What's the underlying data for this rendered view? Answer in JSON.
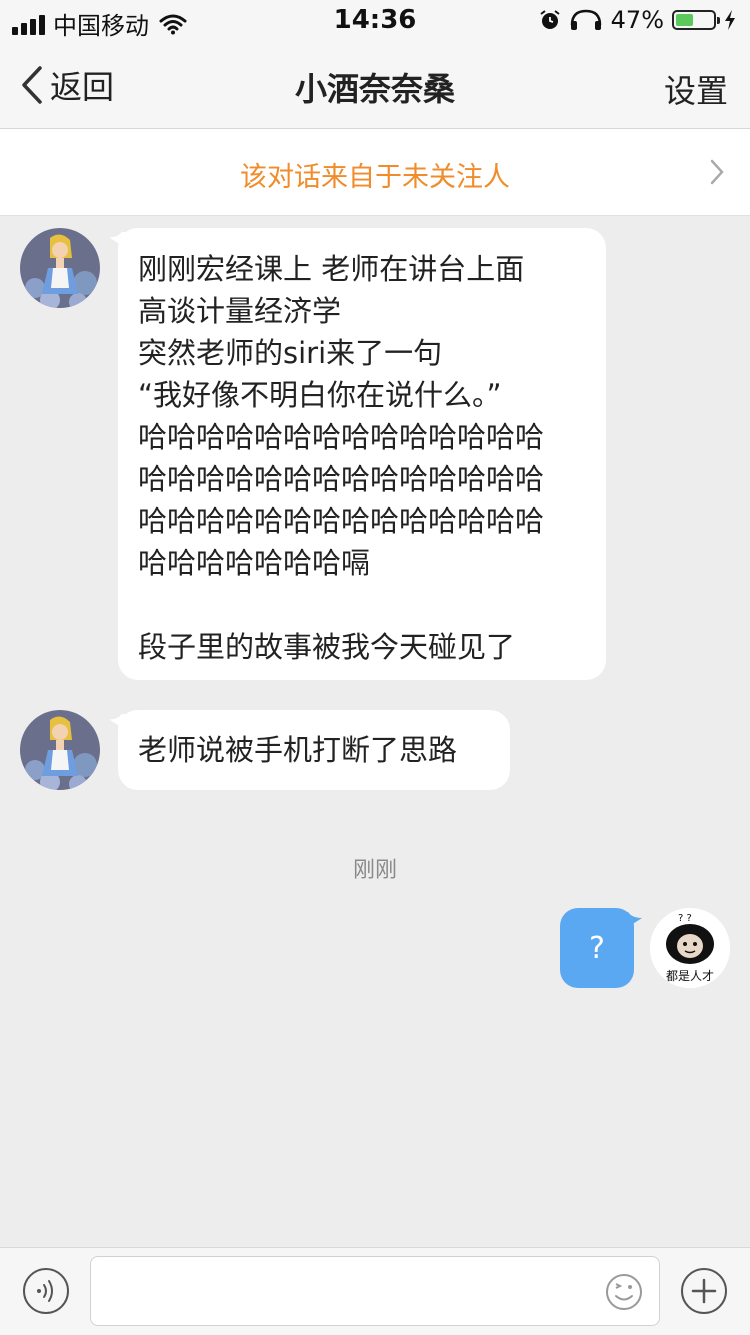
{
  "status_bar": {
    "carrier": "中国移动",
    "time": "14:36",
    "battery_percent": "47%",
    "battery_level": 0.47
  },
  "nav": {
    "back_label": "返回",
    "title": "小酒奈奈桑",
    "settings_label": "设置"
  },
  "notice": {
    "text": "该对话来自于未关注人"
  },
  "messages": {
    "incoming_1": {
      "lines": [
        "刚刚宏经课上 老师在讲台上面",
        "高谈计量经济学",
        "突然老师的siri来了一句",
        "“我好像不明白你在说什么。”",
        "哈哈哈哈哈哈哈哈哈哈哈哈哈哈",
        "哈哈哈哈哈哈哈哈哈哈哈哈哈哈",
        "哈哈哈哈哈哈哈哈哈哈哈哈哈哈",
        "哈哈哈哈哈哈哈嗝",
        "",
        "段子里的故事被我今天碰见了"
      ]
    },
    "incoming_2": {
      "text": "老师说被手机打断了思路"
    },
    "timestamp": "刚刚",
    "outgoing_1": {
      "text": "?"
    }
  },
  "my_avatar": {
    "caption": "都是人才"
  },
  "input": {
    "placeholder": ""
  },
  "colors": {
    "notice_text": "#f08c2a",
    "outgoing_bubble": "#5aa8f2",
    "background": "#ededed"
  }
}
